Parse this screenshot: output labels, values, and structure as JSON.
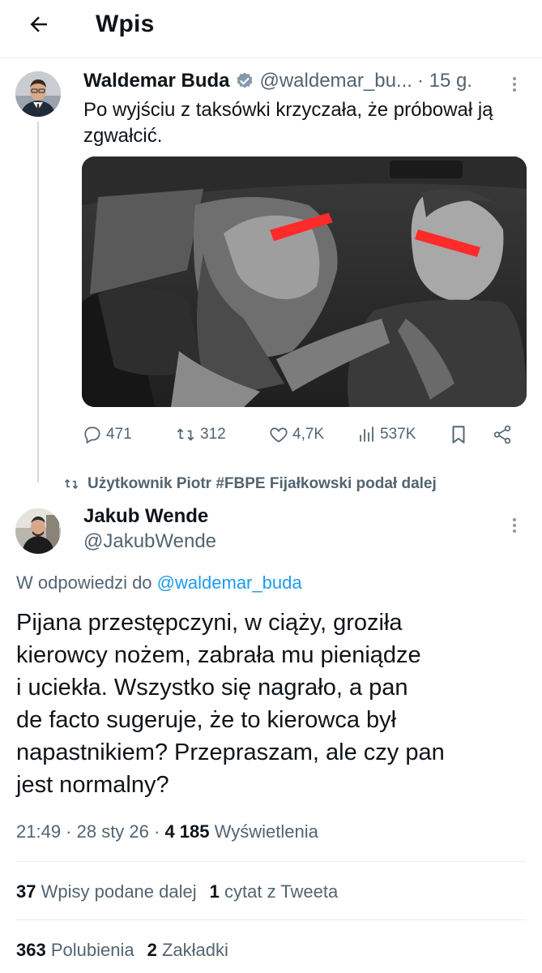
{
  "header": {
    "title": "Wpis",
    "back_icon": "arrow-left-icon"
  },
  "tweet": {
    "author_name": "Waldemar Buda",
    "author_handle": "@waldemar_bu...",
    "time": "· 15 g.",
    "text": "Po wyjściu z taksówki krzyczała, że próbował ją zgwałcić.",
    "media_description_icon": "video-thumbnail",
    "stats": {
      "replies": "471",
      "retweets": "312",
      "likes": "4,7K",
      "views": "537K"
    }
  },
  "retweet_notice": "Użytkownik Piotr #FBPE Fijałkowski podał dalej",
  "reply": {
    "author_name": "Jakub Wende",
    "author_handle": "@JakubWende",
    "reply_to_prefix": "W odpowiedzi do",
    "reply_to_handle": "@waldemar_buda",
    "text": "Pijana przestępczyni, w ciąży, groziła\nkierowcy nożem, zabrała mu pieniądze\ni uciekła. Wszystko się nagrało, a pan\nde facto sugeruje, że to kierowca był\nnapastnikiem? Przepraszam, ale czy pan\njest normalny?",
    "time_date": "21:49 · 28 sty 26 ·",
    "views_count": "4 185",
    "views_label": "Wyświetlenia",
    "retweets_count": "37",
    "retweets_label": "Wpisy podane dalej",
    "quotes_count": "1",
    "quotes_label": "cytat z Tweeta",
    "likes_count": "363",
    "likes_label": "Polubienia",
    "bookmarks_count": "2",
    "bookmarks_label": "Zakładki"
  },
  "colors": {
    "text": "#0f1419",
    "secondary": "#536471",
    "link": "#1d9bf0",
    "verified": "#829aab",
    "divider": "#e7ecf0"
  }
}
